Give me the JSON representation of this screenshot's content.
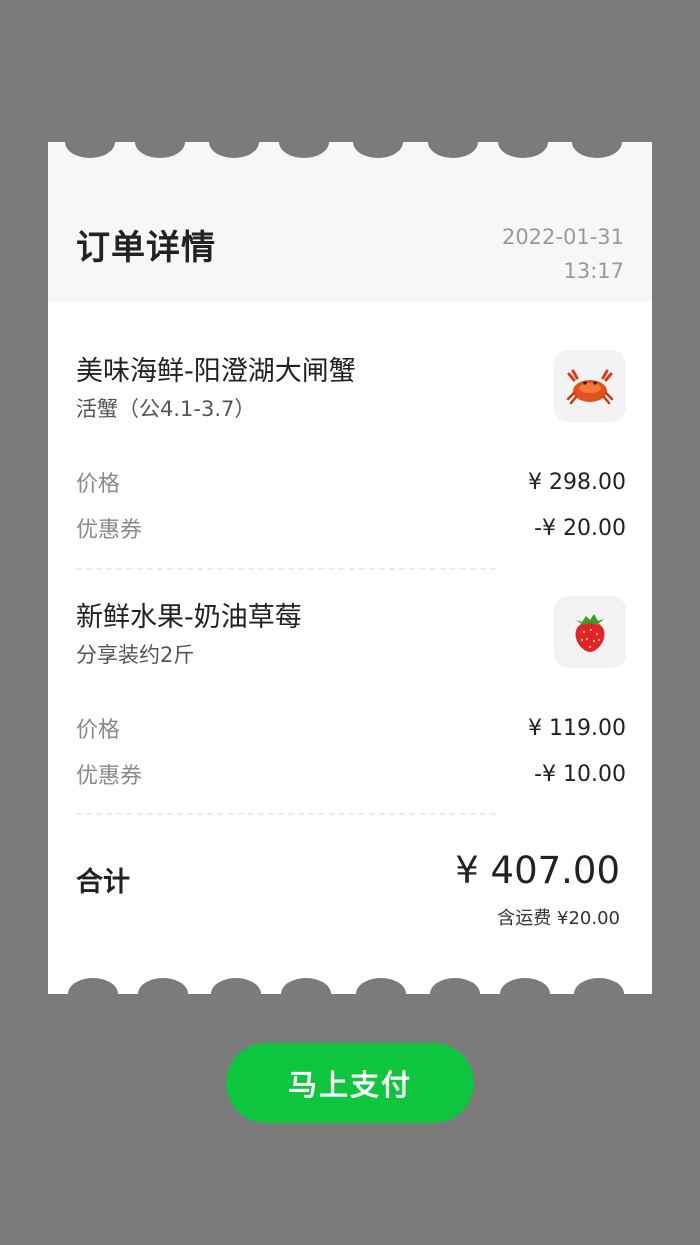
{
  "receipt": {
    "title": "订单详情",
    "date": "2022-01-31",
    "time": "13:17"
  },
  "items": [
    {
      "name": "美味海鲜-阳澄湖大闸蟹",
      "spec": "活蟹（公4.1-3.7）",
      "icon": "crab-icon",
      "price_label": "价格",
      "price": "¥ 298.00",
      "coupon_label": "优惠券",
      "coupon": "-¥ 20.00"
    },
    {
      "name": "新鲜水果-奶油草莓",
      "spec": "分享装约2斤",
      "icon": "strawberry-icon",
      "price_label": "价格",
      "price": "¥ 119.00",
      "coupon_label": "优惠券",
      "coupon": "-¥ 10.00"
    }
  ],
  "summary": {
    "total_label": "合计",
    "total_amount": "¥ 407.00",
    "shipping_note": "含运费 ¥20.00"
  },
  "actions": {
    "pay_label": "马上支付"
  },
  "colors": {
    "background": "#7b7b7b",
    "pay_button": "#0dc63e"
  }
}
